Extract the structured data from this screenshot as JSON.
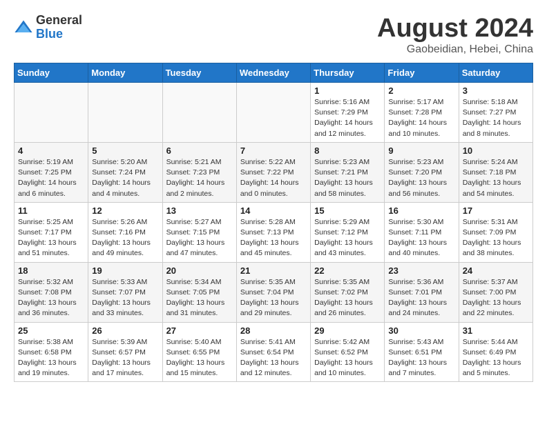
{
  "header": {
    "logo_general": "General",
    "logo_blue": "Blue",
    "month_title": "August 2024",
    "location": "Gaobeidian, Hebei, China"
  },
  "weekdays": [
    "Sunday",
    "Monday",
    "Tuesday",
    "Wednesday",
    "Thursday",
    "Friday",
    "Saturday"
  ],
  "weeks": [
    [
      {
        "day": "",
        "info": ""
      },
      {
        "day": "",
        "info": ""
      },
      {
        "day": "",
        "info": ""
      },
      {
        "day": "",
        "info": ""
      },
      {
        "day": "1",
        "info": "Sunrise: 5:16 AM\nSunset: 7:29 PM\nDaylight: 14 hours\nand 12 minutes."
      },
      {
        "day": "2",
        "info": "Sunrise: 5:17 AM\nSunset: 7:28 PM\nDaylight: 14 hours\nand 10 minutes."
      },
      {
        "day": "3",
        "info": "Sunrise: 5:18 AM\nSunset: 7:27 PM\nDaylight: 14 hours\nand 8 minutes."
      }
    ],
    [
      {
        "day": "4",
        "info": "Sunrise: 5:19 AM\nSunset: 7:25 PM\nDaylight: 14 hours\nand 6 minutes."
      },
      {
        "day": "5",
        "info": "Sunrise: 5:20 AM\nSunset: 7:24 PM\nDaylight: 14 hours\nand 4 minutes."
      },
      {
        "day": "6",
        "info": "Sunrise: 5:21 AM\nSunset: 7:23 PM\nDaylight: 14 hours\nand 2 minutes."
      },
      {
        "day": "7",
        "info": "Sunrise: 5:22 AM\nSunset: 7:22 PM\nDaylight: 14 hours\nand 0 minutes."
      },
      {
        "day": "8",
        "info": "Sunrise: 5:23 AM\nSunset: 7:21 PM\nDaylight: 13 hours\nand 58 minutes."
      },
      {
        "day": "9",
        "info": "Sunrise: 5:23 AM\nSunset: 7:20 PM\nDaylight: 13 hours\nand 56 minutes."
      },
      {
        "day": "10",
        "info": "Sunrise: 5:24 AM\nSunset: 7:18 PM\nDaylight: 13 hours\nand 54 minutes."
      }
    ],
    [
      {
        "day": "11",
        "info": "Sunrise: 5:25 AM\nSunset: 7:17 PM\nDaylight: 13 hours\nand 51 minutes."
      },
      {
        "day": "12",
        "info": "Sunrise: 5:26 AM\nSunset: 7:16 PM\nDaylight: 13 hours\nand 49 minutes."
      },
      {
        "day": "13",
        "info": "Sunrise: 5:27 AM\nSunset: 7:15 PM\nDaylight: 13 hours\nand 47 minutes."
      },
      {
        "day": "14",
        "info": "Sunrise: 5:28 AM\nSunset: 7:13 PM\nDaylight: 13 hours\nand 45 minutes."
      },
      {
        "day": "15",
        "info": "Sunrise: 5:29 AM\nSunset: 7:12 PM\nDaylight: 13 hours\nand 43 minutes."
      },
      {
        "day": "16",
        "info": "Sunrise: 5:30 AM\nSunset: 7:11 PM\nDaylight: 13 hours\nand 40 minutes."
      },
      {
        "day": "17",
        "info": "Sunrise: 5:31 AM\nSunset: 7:09 PM\nDaylight: 13 hours\nand 38 minutes."
      }
    ],
    [
      {
        "day": "18",
        "info": "Sunrise: 5:32 AM\nSunset: 7:08 PM\nDaylight: 13 hours\nand 36 minutes."
      },
      {
        "day": "19",
        "info": "Sunrise: 5:33 AM\nSunset: 7:07 PM\nDaylight: 13 hours\nand 33 minutes."
      },
      {
        "day": "20",
        "info": "Sunrise: 5:34 AM\nSunset: 7:05 PM\nDaylight: 13 hours\nand 31 minutes."
      },
      {
        "day": "21",
        "info": "Sunrise: 5:35 AM\nSunset: 7:04 PM\nDaylight: 13 hours\nand 29 minutes."
      },
      {
        "day": "22",
        "info": "Sunrise: 5:35 AM\nSunset: 7:02 PM\nDaylight: 13 hours\nand 26 minutes."
      },
      {
        "day": "23",
        "info": "Sunrise: 5:36 AM\nSunset: 7:01 PM\nDaylight: 13 hours\nand 24 minutes."
      },
      {
        "day": "24",
        "info": "Sunrise: 5:37 AM\nSunset: 7:00 PM\nDaylight: 13 hours\nand 22 minutes."
      }
    ],
    [
      {
        "day": "25",
        "info": "Sunrise: 5:38 AM\nSunset: 6:58 PM\nDaylight: 13 hours\nand 19 minutes."
      },
      {
        "day": "26",
        "info": "Sunrise: 5:39 AM\nSunset: 6:57 PM\nDaylight: 13 hours\nand 17 minutes."
      },
      {
        "day": "27",
        "info": "Sunrise: 5:40 AM\nSunset: 6:55 PM\nDaylight: 13 hours\nand 15 minutes."
      },
      {
        "day": "28",
        "info": "Sunrise: 5:41 AM\nSunset: 6:54 PM\nDaylight: 13 hours\nand 12 minutes."
      },
      {
        "day": "29",
        "info": "Sunrise: 5:42 AM\nSunset: 6:52 PM\nDaylight: 13 hours\nand 10 minutes."
      },
      {
        "day": "30",
        "info": "Sunrise: 5:43 AM\nSunset: 6:51 PM\nDaylight: 13 hours\nand 7 minutes."
      },
      {
        "day": "31",
        "info": "Sunrise: 5:44 AM\nSunset: 6:49 PM\nDaylight: 13 hours\nand 5 minutes."
      }
    ]
  ]
}
